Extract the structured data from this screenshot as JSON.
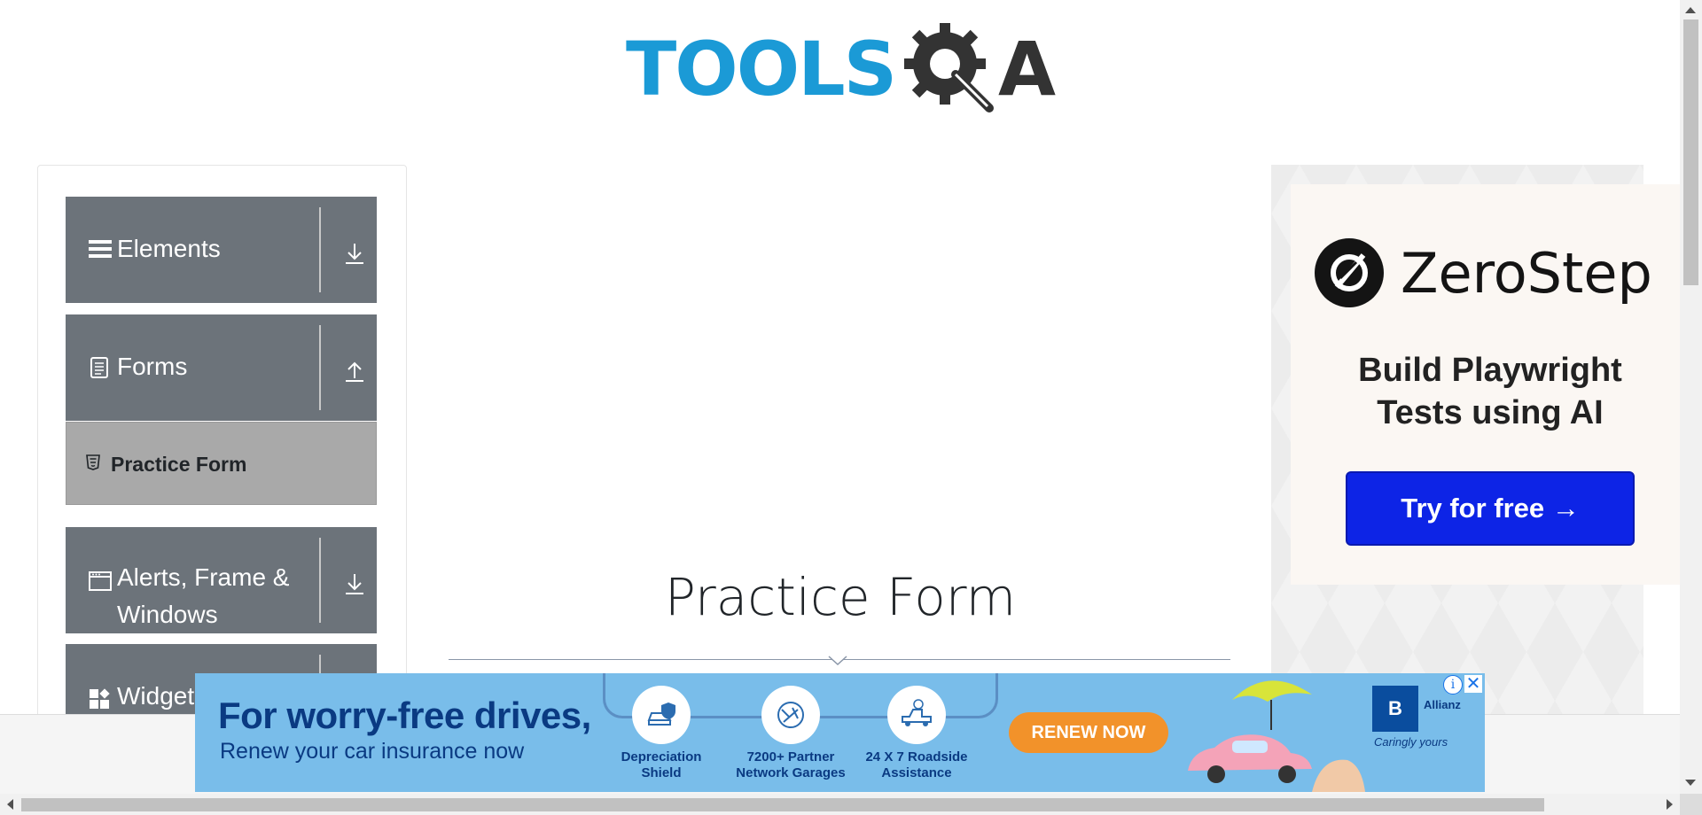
{
  "header": {
    "logo_text": "TOOLS",
    "logo_suffix": "A"
  },
  "sidebar": {
    "groups": [
      {
        "label": "Elements",
        "icon": "hamburger-icon",
        "state": "collapsed"
      },
      {
        "label": "Forms",
        "icon": "document-icon",
        "state": "expanded"
      },
      {
        "label": "Alerts, Frame & Windows",
        "icon": "window-icon",
        "state": "collapsed"
      },
      {
        "label": "Widgets",
        "icon": "widgets-icon",
        "state": "collapsed"
      }
    ],
    "active_item": {
      "label": "Practice Form",
      "icon": "html5-icon"
    }
  },
  "main": {
    "title": "Practice Form"
  },
  "ad_right": {
    "brand": "ZeroStep",
    "tagline_line1": "Build Playwright",
    "tagline_line2": "Tests using AI",
    "cta": "Try for free →",
    "cta_color": "#0d24e6"
  },
  "ad_bottom": {
    "headline": "For worry-free drives,",
    "subline": "Renew your car insurance now",
    "features": [
      {
        "line1": "Depreciation",
        "line2": "Shield"
      },
      {
        "line1": "7200+ Partner",
        "line2": "Network Garages"
      },
      {
        "line1": "24 X 7 Roadside",
        "line2": "Assistance"
      }
    ],
    "cta": "RENEW NOW",
    "brand": "B",
    "partner": "Allianz",
    "brand_tagline": "Caringly yours",
    "info_icon": "i",
    "close_icon": "✕"
  },
  "colors": {
    "sidebar_group": "#6c737a",
    "active_item": "#a9a9a9",
    "logo_blue": "#1b9ad6"
  }
}
